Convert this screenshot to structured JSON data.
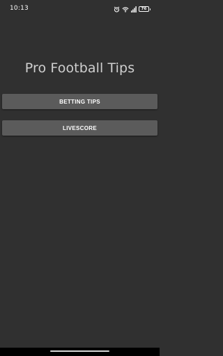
{
  "status_bar": {
    "time": "10:13",
    "battery_level": "76",
    "icons": [
      "alarm-icon",
      "wifi-icon",
      "signal-icon",
      "battery-icon"
    ]
  },
  "app": {
    "title": "Pro Football Tips"
  },
  "buttons": {
    "betting_tips": "BETTING TIPS",
    "livescore": "LIVESCORE"
  },
  "colors": {
    "background": "#303030",
    "button": "#5b5b5b",
    "title_text": "#cfcfcf",
    "nav_bar": "#000000"
  }
}
